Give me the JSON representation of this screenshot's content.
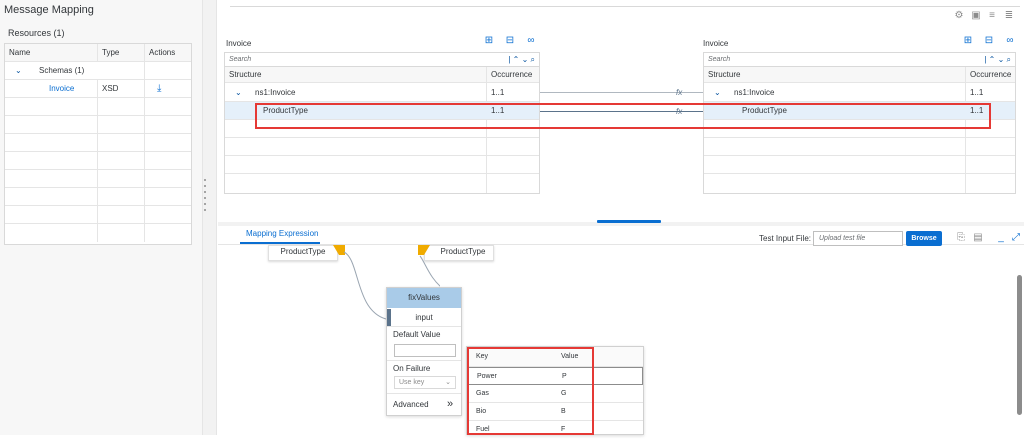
{
  "app": {
    "title": "Message Mapping"
  },
  "resources": {
    "title": "Resources (1)",
    "columns": [
      "Name",
      "Type",
      "Actions"
    ],
    "schemas_label": "Schemas (1)",
    "invoice_name": "Invoice",
    "invoice_type": "XSD"
  },
  "source": {
    "title": "Invoice",
    "search_placeholder": "Search",
    "col_structure": "Structure",
    "col_occurrence": "Occurrence",
    "rows": [
      {
        "name": "ns1:Invoice",
        "occ": "1..1"
      },
      {
        "name": "ProductType",
        "occ": "1..1"
      }
    ]
  },
  "target": {
    "title": "Invoice",
    "search_placeholder": "Search",
    "col_structure": "Structure",
    "col_occurrence": "Occurrence",
    "rows": [
      {
        "name": "ns1:Invoice",
        "occ": "1..1"
      },
      {
        "name": "ProductType",
        "occ": "1..1"
      }
    ]
  },
  "editor": {
    "tab_label": "Mapping Expression",
    "test_input_label": "Test Input File:",
    "upload_placeholder": "Upload test file",
    "browse_label": "Browse",
    "src_node": "ProductType",
    "tgt_node": "ProductType",
    "fix": {
      "title": "fixValues",
      "input": "input",
      "default_value_label": "Default Value",
      "on_failure_label": "On Failure",
      "on_failure_value": "Use key",
      "advanced_label": "Advanced"
    },
    "value_map": {
      "col_key": "Key",
      "col_value": "Value",
      "rows": [
        {
          "key": "Power",
          "value": "P"
        },
        {
          "key": "Gas",
          "value": "G"
        },
        {
          "key": "Bio",
          "value": "B"
        },
        {
          "key": "Fuel",
          "value": "F"
        }
      ]
    }
  },
  "colors": {
    "accent": "#0a6ed1",
    "highlight": "#e53935",
    "node_flag": "#f0ab00",
    "fix_header": "#a9cbe8"
  }
}
